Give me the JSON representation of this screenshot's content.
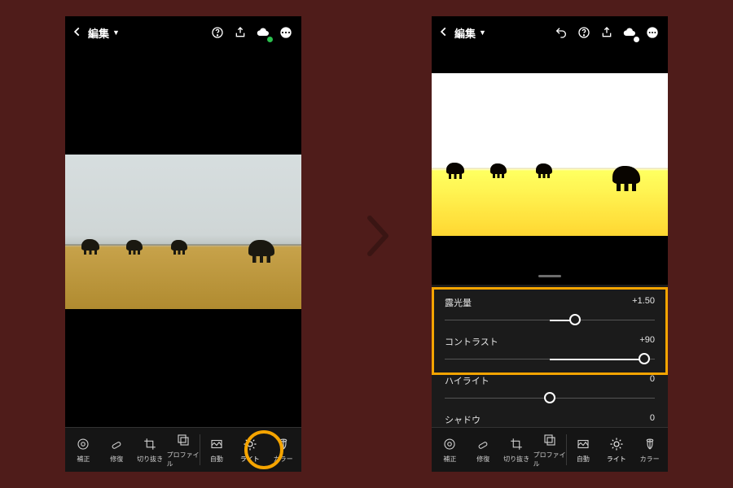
{
  "colors": {
    "accent": "#f5a400",
    "bg": "#4f1c1a"
  },
  "header": {
    "title": "編集",
    "icons": {
      "back": "chevron-left",
      "undo": "undo",
      "help": "help-circle",
      "share": "share",
      "cloud": "cloud-check",
      "more": "more-horizontal"
    }
  },
  "toolbar": {
    "items": [
      {
        "id": "lens",
        "label": "補正"
      },
      {
        "id": "heal",
        "label": "修復"
      },
      {
        "id": "crop",
        "label": "切り抜き"
      },
      {
        "id": "profile",
        "label": "プロファイル"
      },
      {
        "id": "auto",
        "label": "自動"
      },
      {
        "id": "light",
        "label": "ライト"
      },
      {
        "id": "color",
        "label": "カラー"
      }
    ],
    "active": "light",
    "separator_before": "auto"
  },
  "sliders": {
    "exposure": {
      "label": "露光量",
      "value": "+1.50",
      "pos": 0.62
    },
    "contrast": {
      "label": "コントラスト",
      "value": "+90",
      "pos": 0.95
    },
    "highlight": {
      "label": "ハイライト",
      "value": "0",
      "pos": 0.5
    },
    "shadow": {
      "label": "シャドウ",
      "value": "0",
      "pos": 0.5
    }
  }
}
